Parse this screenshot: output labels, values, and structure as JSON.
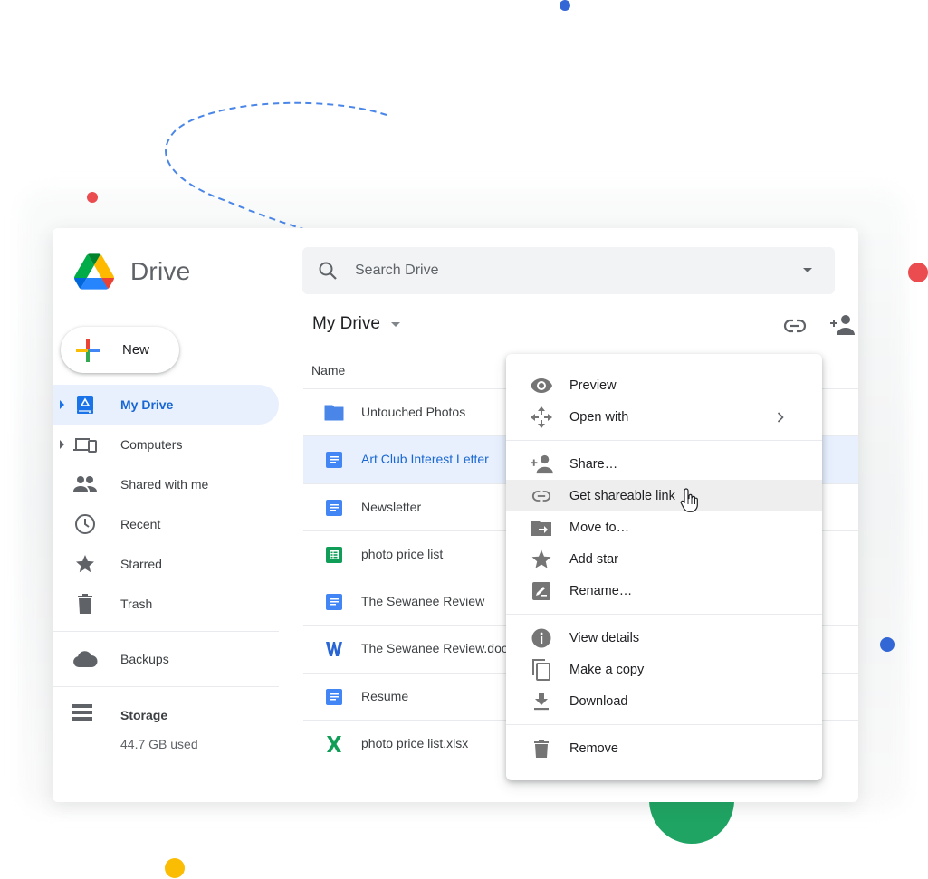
{
  "app": {
    "name": "Drive"
  },
  "new_button": {
    "label": "New"
  },
  "sidebar": {
    "items": [
      {
        "label": "My Drive",
        "icon": "my-drive-icon",
        "active": true,
        "expandable": true
      },
      {
        "label": "Computers",
        "icon": "computers-icon",
        "active": false,
        "expandable": true
      },
      {
        "label": "Shared with me",
        "icon": "shared-icon",
        "active": false,
        "expandable": false
      },
      {
        "label": "Recent",
        "icon": "clock-icon",
        "active": false,
        "expandable": false
      },
      {
        "label": "Starred",
        "icon": "star-icon",
        "active": false,
        "expandable": false
      },
      {
        "label": "Trash",
        "icon": "trash-icon",
        "active": false,
        "expandable": false
      }
    ],
    "backups": {
      "label": "Backups",
      "icon": "cloud-icon"
    },
    "storage": {
      "label": "Storage",
      "used": "44.7 GB used",
      "icon": "storage-icon"
    }
  },
  "search": {
    "placeholder": "Search Drive"
  },
  "breadcrumb": {
    "title": "My Drive"
  },
  "toolbar": {
    "link_icon": "link-icon",
    "share_icon": "add-person-icon"
  },
  "list": {
    "header": {
      "name": "Name"
    },
    "rows": [
      {
        "name": "Untouched Photos",
        "type": "folder",
        "selected": false
      },
      {
        "name": "Art Club Interest Letter",
        "type": "doc",
        "selected": true
      },
      {
        "name": "Newsletter",
        "type": "doc",
        "selected": false
      },
      {
        "name": "photo price list",
        "type": "sheet",
        "selected": false
      },
      {
        "name": "The Sewanee Review",
        "type": "doc",
        "selected": false
      },
      {
        "name": "The Sewanee Review.docx",
        "type": "word",
        "selected": false
      },
      {
        "name": "Resume",
        "type": "doc",
        "selected": false
      },
      {
        "name": "photo price list.xlsx",
        "type": "excel",
        "selected": false
      }
    ]
  },
  "context_menu": {
    "groups": [
      [
        {
          "label": "Preview",
          "icon": "eye-icon"
        },
        {
          "label": "Open with",
          "icon": "open-with-icon",
          "submenu": true
        }
      ],
      [
        {
          "label": "Share…",
          "icon": "add-person-icon"
        },
        {
          "label": "Get shareable link",
          "icon": "link-icon",
          "hovered": true
        },
        {
          "label": "Move to…",
          "icon": "move-to-folder-icon"
        },
        {
          "label": "Add star",
          "icon": "star-icon"
        },
        {
          "label": "Rename…",
          "icon": "rename-icon"
        }
      ],
      [
        {
          "label": "View details",
          "icon": "info-icon"
        },
        {
          "label": "Make a copy",
          "icon": "copy-icon"
        },
        {
          "label": "Download",
          "icon": "download-icon"
        }
      ],
      [
        {
          "label": "Remove",
          "icon": "trash-icon"
        }
      ]
    ]
  },
  "colors": {
    "accent_blue": "#1a73e8",
    "selected_bg": "#e8f0fe",
    "docs_blue": "#4285f4",
    "sheets_green": "#0f9d58",
    "deco_red": "#ea4c4f",
    "deco_yellow": "#fbbc04",
    "deco_green": "#1fa463",
    "deco_blue": "#3367d6"
  }
}
